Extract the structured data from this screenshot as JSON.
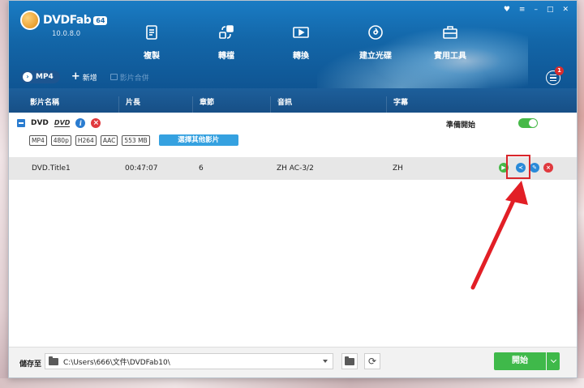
{
  "app": {
    "name": "DVDFab",
    "edition": "64",
    "version": "10.0.8.0"
  },
  "window_controls": [
    "♥",
    "≡",
    "–",
    "□",
    "✕"
  ],
  "nav": [
    {
      "label": "複製",
      "icon": "copy-icon"
    },
    {
      "label": "轉檔",
      "icon": "ripper-icon"
    },
    {
      "label": "轉換",
      "icon": "converter-icon"
    },
    {
      "label": "建立光碟",
      "icon": "creator-icon"
    },
    {
      "label": "實用工具",
      "icon": "toolbox-icon"
    }
  ],
  "subbar": {
    "mode": "MP4",
    "add": "新增",
    "merge": "影片合併"
  },
  "notifications": {
    "count": "1"
  },
  "columns": [
    "影片名稱",
    "片長",
    "章節",
    "音訊",
    "字幕"
  ],
  "source": {
    "type": "DVD",
    "dvd_logo": "DVD",
    "tags": [
      "MP4",
      "480p",
      "H264",
      "AAC",
      "553 MB"
    ],
    "choose_button": "選擇其他影片",
    "status": "準備開始"
  },
  "title_row": {
    "name": "DVD.Title1",
    "duration": "00:47:07",
    "chapters": "6",
    "audio": "ZH  AC-3/2",
    "subtitle": "ZH"
  },
  "footer": {
    "save_label": "儲存至",
    "path": "C:\\Users\\666\\文件\\DVDFab10\\",
    "start": "開始"
  },
  "colors": {
    "brand_blue": "#1366a8",
    "start_green": "#3fb94a",
    "annotation_red": "#d9262b"
  }
}
